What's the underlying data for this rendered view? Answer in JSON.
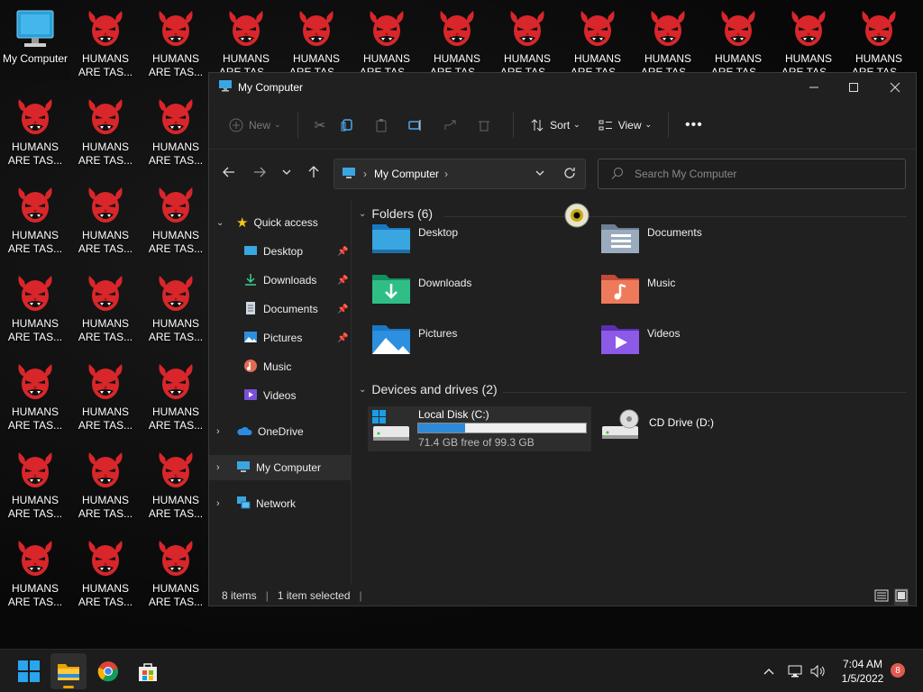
{
  "desktop": {
    "mycomputer_label": "My Computer",
    "humans_label": "HUMANS\nARE TAS...",
    "icon_label_color": "#ffffff"
  },
  "window": {
    "title": "My Computer",
    "toolbar": {
      "new": "New",
      "sort": "Sort",
      "view": "View"
    },
    "address": {
      "crumb": "My Computer"
    },
    "search_placeholder": "Search My Computer",
    "sidebar": {
      "quick_access": "Quick access",
      "desktop": "Desktop",
      "downloads": "Downloads",
      "documents": "Documents",
      "pictures": "Pictures",
      "music": "Music",
      "videos": "Videos",
      "onedrive": "OneDrive",
      "mycomputer": "My Computer",
      "network": "Network"
    },
    "folders_header": "Folders (6)",
    "folders": [
      "Desktop",
      "Documents",
      "Downloads",
      "Music",
      "Pictures",
      "Videos"
    ],
    "devices_header": "Devices and drives (2)",
    "drive_c": {
      "name": "Local Disk (C:)",
      "free": "71.4 GB free of 99.3 GB",
      "used_fraction": 0.28
    },
    "drive_d": {
      "name": "CD Drive (D:)"
    },
    "status": {
      "items": "8 items",
      "selected": "1 item selected"
    }
  },
  "taskbar": {
    "time": "7:04 AM",
    "date": "1/5/2022",
    "notifications": "8"
  },
  "colors": {
    "accent": "#2e8ad8",
    "window_bg": "#202020",
    "taskbar_bg": "#1c1c1c",
    "devil_red": "#d8262a"
  }
}
